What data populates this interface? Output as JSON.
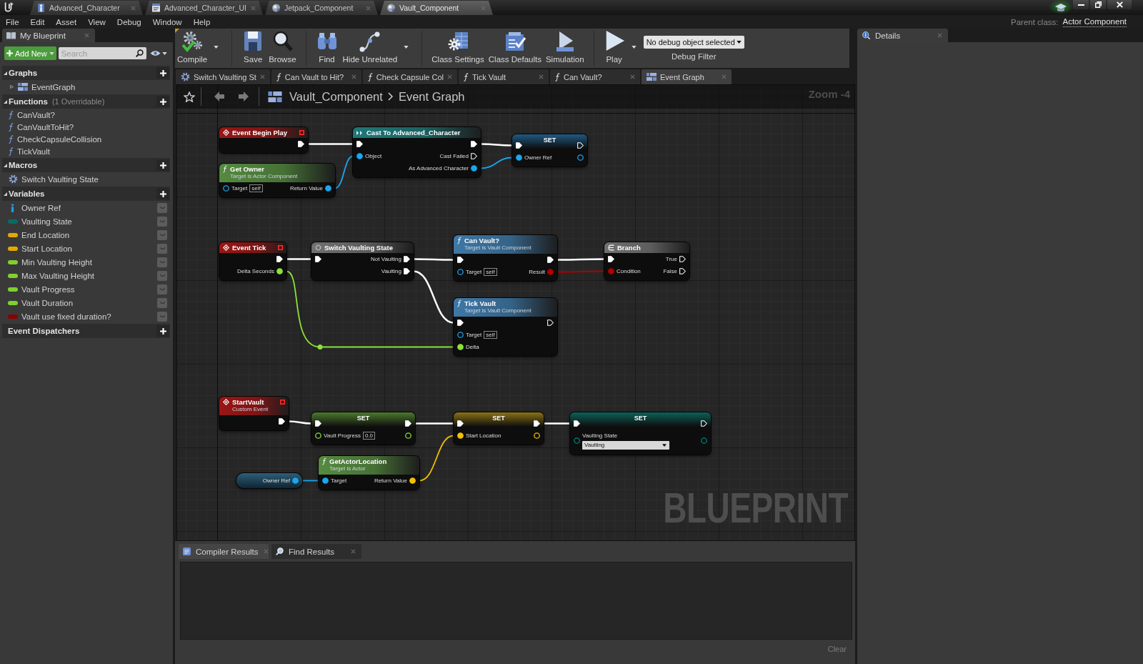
{
  "window": {
    "tabs": [
      {
        "label": "Advanced_Character",
        "kind": "character",
        "selected": false
      },
      {
        "label": "Advanced_Character_UI",
        "kind": "widget",
        "selected": false
      },
      {
        "label": "Jetpack_Component",
        "kind": "component",
        "selected": false
      },
      {
        "label": "Vault_Component",
        "kind": "component",
        "selected": true
      }
    ]
  },
  "menu": {
    "items": [
      "File",
      "Edit",
      "Asset",
      "View",
      "Debug",
      "Window",
      "Help"
    ],
    "parent_class_label": "Parent class:",
    "parent_class": "Actor Component"
  },
  "my_blueprint": {
    "tab": "My Blueprint",
    "add_new": "Add New",
    "search": {
      "placeholder": "Search"
    },
    "sections": [
      {
        "title": "Graphs",
        "expanded": true,
        "items": [
          {
            "label": "EventGraph",
            "kind": "graph",
            "expanded": false
          }
        ]
      },
      {
        "title": "Functions",
        "note": "(1 Overridable)",
        "expanded": true,
        "items": [
          {
            "label": "CanVault?",
            "kind": "function"
          },
          {
            "label": "CanVaultToHit?",
            "kind": "function"
          },
          {
            "label": "CheckCapsuleCollision",
            "kind": "function"
          },
          {
            "label": "TickVault",
            "kind": "function"
          }
        ]
      },
      {
        "title": "Macros",
        "expanded": true,
        "items": [
          {
            "label": "Switch Vaulting State",
            "kind": "macro"
          }
        ]
      },
      {
        "title": "Variables",
        "expanded": true,
        "items": [
          {
            "label": "Owner Ref",
            "kind": "reference",
            "color": "#1e9be8",
            "public": false
          },
          {
            "label": "Vaulting State",
            "kind": "value",
            "color": "#0b6b63",
            "public": false
          },
          {
            "label": "End Location",
            "kind": "value",
            "color": "#e6a800",
            "public": false
          },
          {
            "label": "Start Location",
            "kind": "value",
            "color": "#e6a800",
            "public": false
          },
          {
            "label": "Min Vaulting Height",
            "kind": "value",
            "color": "#7fd12e",
            "public": false
          },
          {
            "label": "Max Vaulting Height",
            "kind": "value",
            "color": "#7fd12e",
            "public": false
          },
          {
            "label": "Vault Progress",
            "kind": "value",
            "color": "#7fd12e",
            "public": false
          },
          {
            "label": "Vault Duration",
            "kind": "value",
            "color": "#7fd12e",
            "public": false
          },
          {
            "label": "Vault use fixed duration?",
            "kind": "value",
            "color": "#8c0000",
            "public": false
          }
        ]
      },
      {
        "title": "Event Dispatchers"
      }
    ]
  },
  "toolbar": {
    "groups": [
      [
        {
          "label": "Compile",
          "kind": "compile",
          "dropdown": true
        }
      ],
      [
        {
          "label": "Save",
          "kind": "save",
          "dropdown": false
        },
        {
          "label": "Browse",
          "kind": "browse",
          "dropdown": false
        }
      ],
      [
        {
          "label": "Find",
          "kind": "find",
          "dropdown": false
        },
        {
          "label": "Hide Unrelated",
          "kind": "hide-unrelated",
          "dropdown": true
        }
      ],
      [
        {
          "label": "Class Settings",
          "kind": "class-settings",
          "dropdown": false
        },
        {
          "label": "Class Defaults",
          "kind": "class-defaults",
          "dropdown": false
        },
        {
          "label": "Simulation",
          "kind": "simulation",
          "dropdown": false
        }
      ],
      [
        {
          "label": "Play",
          "kind": "play",
          "dropdown": true
        }
      ]
    ],
    "debug_filter": {
      "value": "No debug object selected",
      "label": "Debug Filter"
    }
  },
  "graph_tabs": [
    {
      "label": "Switch Vaulting St",
      "kind": "macro",
      "selected": false
    },
    {
      "label": "Can Vault to Hit?",
      "kind": "function",
      "selected": false
    },
    {
      "label": "Check Capsule Col",
      "kind": "function",
      "selected": false
    },
    {
      "label": "Tick Vault",
      "kind": "function",
      "selected": false
    },
    {
      "label": "Can Vault?",
      "kind": "function",
      "selected": false
    },
    {
      "label": "Event Graph",
      "kind": "graph",
      "selected": true
    }
  ],
  "graph": {
    "breadcrumb": [
      "Vault_Component",
      "Event Graph"
    ],
    "zoom": "Zoom -4",
    "corner_label": "BLUEPRINT",
    "nodes": [
      {
        "kind": "event",
        "title": "Event Begin Play",
        "rows": [
          {
            "out": {
              "kind": "exec",
              "connected": true
            }
          }
        ]
      },
      {
        "kind": "pure",
        "title": "Get Owner",
        "subtitle": "Target is Actor Component",
        "rows": [
          {
            "in": {
              "kind": "object",
              "label": "Target",
              "connected": false,
              "value": "self"
            },
            "out": {
              "kind": "object",
              "label": "Return Value",
              "connected": true
            }
          }
        ]
      },
      {
        "kind": "cast",
        "title": "Cast To Advanced_Character",
        "rows": [
          {
            "in": {
              "kind": "exec",
              "connected": true
            },
            "out": {
              "kind": "exec",
              "connected": true
            }
          },
          {
            "in": {
              "kind": "object",
              "label": "Object",
              "connected": true
            },
            "out": {
              "kind": "exec",
              "label": "Cast Failed",
              "connected": false
            }
          },
          {
            "out": {
              "kind": "object",
              "label": "As Advanced Character",
              "connected": true
            }
          }
        ]
      },
      {
        "kind": "set",
        "title": "SET",
        "rows": [
          {
            "in": {
              "kind": "exec",
              "connected": true
            },
            "out": {
              "kind": "exec",
              "connected": false
            }
          },
          {
            "in": {
              "kind": "object",
              "label": "Owner Ref",
              "connected": true
            },
            "out": {
              "kind": "object",
              "connected": false
            }
          }
        ]
      },
      {
        "kind": "event",
        "title": "Event Tick",
        "rows": [
          {
            "out": {
              "kind": "exec",
              "connected": true
            }
          },
          {
            "out": {
              "kind": "float",
              "label": "Delta Seconds",
              "connected": true
            }
          }
        ]
      },
      {
        "kind": "macro",
        "title": "Switch Vaulting State",
        "rows": [
          {
            "in": {
              "kind": "exec",
              "connected": true
            },
            "out": {
              "kind": "exec",
              "label": "Not Vaulting",
              "connected": true
            }
          },
          {
            "out": {
              "kind": "exec",
              "label": "Vaulting",
              "connected": true
            }
          }
        ]
      },
      {
        "kind": "function",
        "title": "Can Vault?",
        "subtitle": "Target is Vault Component",
        "rows": [
          {
            "in": {
              "kind": "exec",
              "connected": true
            },
            "out": {
              "kind": "exec",
              "connected": true
            }
          },
          {
            "in": {
              "kind": "object",
              "label": "Target",
              "connected": false,
              "value": "self"
            },
            "out": {
              "kind": "bool",
              "label": "Result",
              "connected": true
            }
          }
        ]
      },
      {
        "kind": "branch",
        "title": "Branch",
        "rows": [
          {
            "in": {
              "kind": "exec",
              "connected": true
            },
            "out": {
              "kind": "exec",
              "label": "True",
              "connected": false
            }
          },
          {
            "in": {
              "kind": "bool",
              "label": "Condition",
              "connected": true
            },
            "out": {
              "kind": "exec",
              "label": "False",
              "connected": false
            }
          }
        ]
      },
      {
        "kind": "function",
        "title": "Tick Vault",
        "subtitle": "Target is Vault Component",
        "rows": [
          {
            "in": {
              "kind": "exec",
              "connected": true
            },
            "out": {
              "kind": "exec",
              "connected": false
            }
          },
          {
            "in": {
              "kind": "object",
              "label": "Target",
              "connected": false,
              "value": "self"
            }
          },
          {
            "in": {
              "kind": "float",
              "label": "Delta",
              "connected": true
            }
          }
        ]
      },
      {
        "kind": "event",
        "title": "StartVault",
        "subtitle": "Custom Event",
        "rows": [
          {
            "out": {
              "kind": "exec",
              "connected": true
            }
          }
        ]
      },
      {
        "kind": "set",
        "title": "SET",
        "rows": [
          {
            "in": {
              "kind": "exec",
              "connected": true
            },
            "out": {
              "kind": "exec",
              "connected": true
            }
          },
          {
            "in": {
              "kind": "float",
              "label": "Vault Progress",
              "connected": false,
              "value": "0.0"
            },
            "out": {
              "kind": "float",
              "connected": false
            }
          }
        ]
      },
      {
        "kind": "set",
        "title": "SET",
        "rows": [
          {
            "in": {
              "kind": "exec",
              "connected": true
            },
            "out": {
              "kind": "exec",
              "connected": true
            }
          },
          {
            "in": {
              "kind": "vector",
              "label": "Start Location",
              "connected": true
            },
            "out": {
              "kind": "vector",
              "connected": false
            }
          }
        ]
      },
      {
        "kind": "set",
        "title": "SET",
        "rows": [
          {
            "in": {
              "kind": "exec",
              "connected": true
            },
            "out": {
              "kind": "exec",
              "connected": false
            }
          },
          {
            "in": {
              "kind": "enum",
              "label": "Vaulting State",
              "connected": false,
              "value": "Vaulting"
            },
            "out": {
              "kind": "enum",
              "connected": false
            }
          }
        ]
      },
      {
        "kind": "getter",
        "rows": [
          {
            "out": {
              "kind": "object",
              "label": "Owner Ref",
              "connected": true
            }
          }
        ]
      },
      {
        "kind": "pure",
        "title": "GetActorLocation",
        "subtitle": "Target is Actor",
        "rows": [
          {
            "in": {
              "kind": "object",
              "label": "Target",
              "connected": true
            },
            "out": {
              "kind": "vector",
              "label": "Return Value",
              "connected": true
            }
          }
        ]
      }
    ]
  },
  "bottom_panel": {
    "tabs": [
      {
        "label": "Compiler Results",
        "kind": "compiler",
        "selected": true
      },
      {
        "label": "Find Results",
        "kind": "find",
        "selected": false
      }
    ],
    "clear": {
      "label": "Clear",
      "disabled": true
    }
  },
  "details": {
    "tab": "Details"
  }
}
